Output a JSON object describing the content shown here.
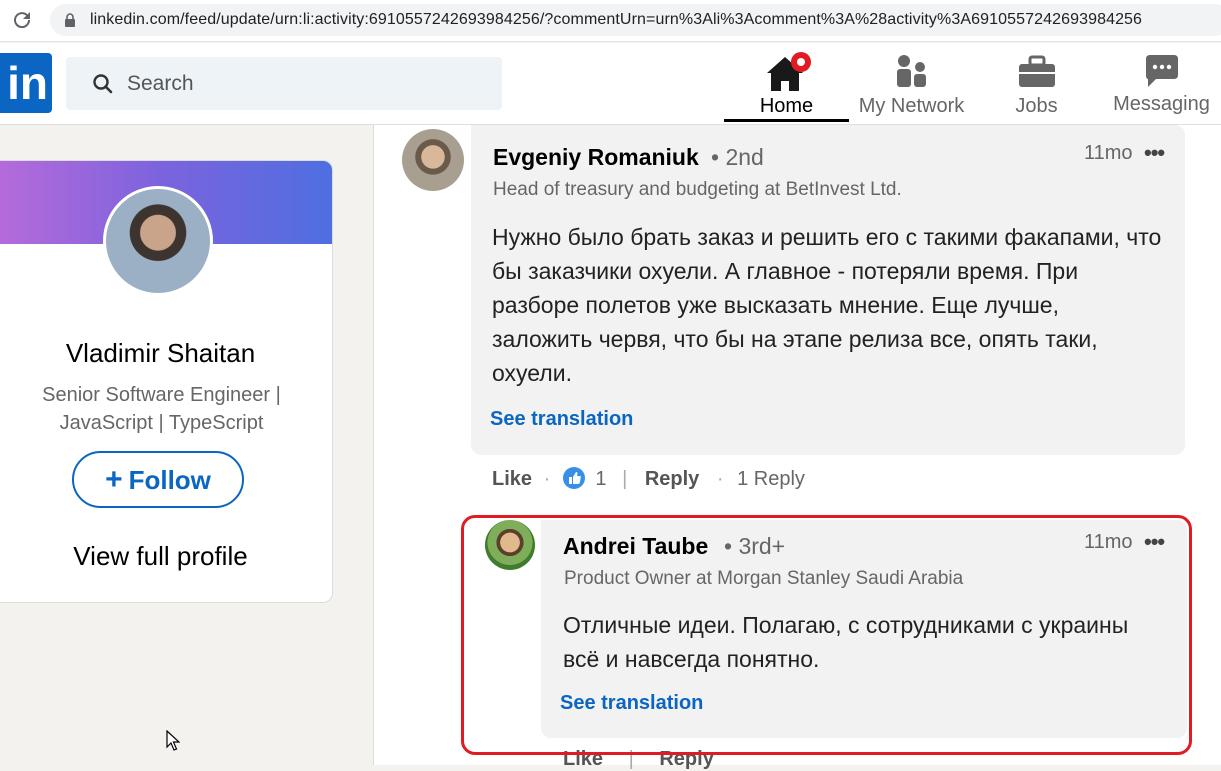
{
  "browser": {
    "url": "linkedin.com/feed/update/urn:li:activity:6910557242693984256/?commentUrn=urn%3Ali%3Acomment%3A%28activity%3A6910557242693984256"
  },
  "header": {
    "logo": "in",
    "search_placeholder": "Search",
    "nav": {
      "home": "Home",
      "network": "My Network",
      "jobs": "Jobs",
      "messaging": "Messaging"
    },
    "colors": {
      "brand": "#0a66c2",
      "notification": "#e01b24"
    }
  },
  "profile_card": {
    "name": "Vladimir Shaitan",
    "headline": "Senior Software Engineer | JavaScript | TypeScript",
    "follow_label": "Follow",
    "follow_plus": "+",
    "view_profile": "View full profile"
  },
  "comments": [
    {
      "author": "Evgeniy Romaniuk",
      "degree": "• 2nd",
      "headline": "Head of treasury and budgeting at BetInvest Ltd.",
      "time": "11mo",
      "more": "•••",
      "text": "Нужно было брать заказ и решить его с такими факапами, что бы заказчики охуели. А главное - потеряли время. При разборе полетов уже высказать мнение. Еще лучше, заложить червя, что бы на этапе релиза все, опять таки, охуели.",
      "translate": "See translation",
      "like": "Like",
      "dot1": "·",
      "reaction_count": "1",
      "pipe": "|",
      "reply": "Reply",
      "dot2": "·",
      "replies": "1 Reply"
    },
    {
      "author": "Andrei Taube",
      "degree": "• 3rd+",
      "headline": "Product Owner at Morgan Stanley Saudi Arabia",
      "time": "11mo",
      "more": "•••",
      "text": "Отличные идеи. Полагаю, с сотрудниками с украины всё и навсегда понятно.",
      "translate": "See translation",
      "like": "Like",
      "pipe": "|",
      "reply": "Reply"
    }
  ]
}
